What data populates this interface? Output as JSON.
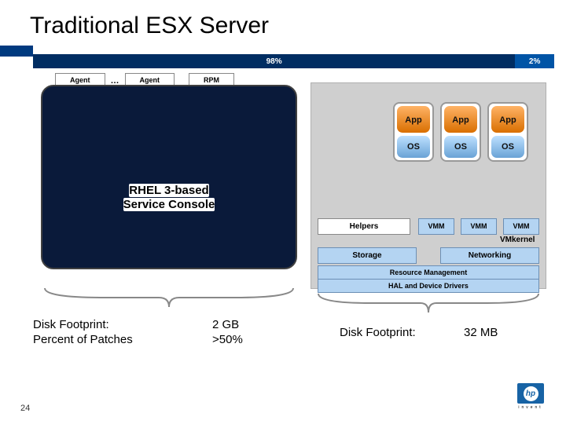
{
  "title": "Traditional ESX Server",
  "page_number": "24",
  "percent_bar": {
    "left": "98%",
    "right": "2%"
  },
  "tags": {
    "agent": "Agent",
    "ellipsis": "…",
    "rpm": "RPM"
  },
  "left_panel": {
    "line1": "RHEL 3-based",
    "line2": "Service Console"
  },
  "vm": {
    "app": "App",
    "os": "OS"
  },
  "rows": {
    "helpers": "Helpers",
    "vmm": "VMM",
    "vmkernel": "VMkernel",
    "storage": "Storage",
    "networking": "Networking",
    "resource_mgmt": "Resource Management",
    "hal": "HAL and Device Drivers"
  },
  "footprint": {
    "left_label_l1": "Disk Footprint:",
    "left_label_l2": "Percent of Patches",
    "left_value_l1": "2 GB",
    "left_value_l2": ">50%",
    "right_label": "Disk Footprint:",
    "right_value": "32 MB"
  },
  "logo": {
    "glyph": "hp",
    "text": "invent"
  }
}
